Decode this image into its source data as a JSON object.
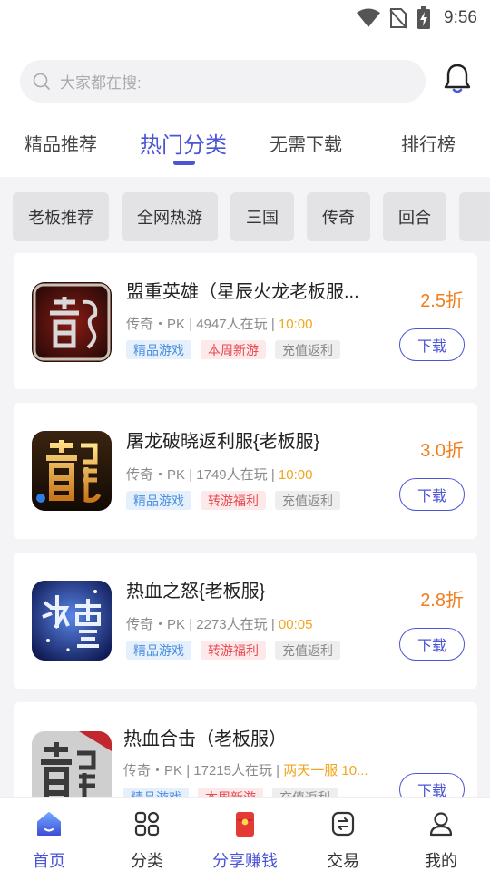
{
  "status_bar": {
    "time": "9:56",
    "icons": [
      "wifi-icon",
      "no-sim-icon",
      "battery-charging-icon"
    ]
  },
  "search": {
    "placeholder": "大家都在搜:",
    "icon": "search-icon"
  },
  "notification": {
    "icon": "bell-icon"
  },
  "tabs": [
    {
      "label": "精品推荐",
      "active": false
    },
    {
      "label": "热门分类",
      "active": true
    },
    {
      "label": "无需下载",
      "active": false
    },
    {
      "label": "排行榜",
      "active": false
    }
  ],
  "accent_color": "#4b55d6",
  "categories": [
    "老板推荐",
    "全网热游",
    "三国",
    "传奇",
    "回合"
  ],
  "games": [
    {
      "title": "盟重英雄（星辰火龙老板服...",
      "genre": "传奇",
      "mode": "PK",
      "players": "4947人在玩",
      "time": "10:00",
      "tags": [
        {
          "text": "精品游戏",
          "style": "blue"
        },
        {
          "text": "本周新游",
          "style": "red"
        },
        {
          "text": "充值返利",
          "style": "gray"
        }
      ],
      "discount": "2.5折",
      "action": "下载",
      "icon": "dragon-game-icon"
    },
    {
      "title": "屠龙破晓返利服{老板服}",
      "genre": "传奇",
      "mode": "PK",
      "players": "1749人在玩",
      "time": "10:00",
      "tags": [
        {
          "text": "精品游戏",
          "style": "blue"
        },
        {
          "text": "转游福利",
          "style": "red"
        },
        {
          "text": "充值返利",
          "style": "gray"
        }
      ],
      "discount": "3.0折",
      "action": "下载",
      "icon": "golden-dragon-game-icon"
    },
    {
      "title": "热血之怒{老板服}",
      "genre": "传奇",
      "mode": "PK",
      "players": "2273人在玩",
      "time": "00:05",
      "tags": [
        {
          "text": "精品游戏",
          "style": "blue"
        },
        {
          "text": "转游福利",
          "style": "red"
        },
        {
          "text": "充值返利",
          "style": "gray"
        }
      ],
      "discount": "2.8折",
      "action": "下载",
      "icon": "ice-snow-game-icon"
    },
    {
      "title": "热血合击（老板服）",
      "genre": "传奇",
      "mode": "PK",
      "players": "17215人在玩",
      "time": "两天一服 10...",
      "tags": [
        {
          "text": "精品游戏",
          "style": "blue"
        },
        {
          "text": "本周新游",
          "style": "red"
        },
        {
          "text": "充值返利",
          "style": "gray"
        }
      ],
      "discount": "",
      "action": "下载",
      "icon": "stone-dragon-game-icon"
    }
  ],
  "bottom_nav": [
    {
      "label": "首页",
      "icon": "home-icon",
      "active": true
    },
    {
      "label": "分类",
      "icon": "grid-icon",
      "active": false
    },
    {
      "label": "分享赚钱",
      "icon": "red-envelope-icon",
      "active": false
    },
    {
      "label": "交易",
      "icon": "trade-icon",
      "active": false
    },
    {
      "label": "我的",
      "icon": "profile-icon",
      "active": false
    }
  ]
}
